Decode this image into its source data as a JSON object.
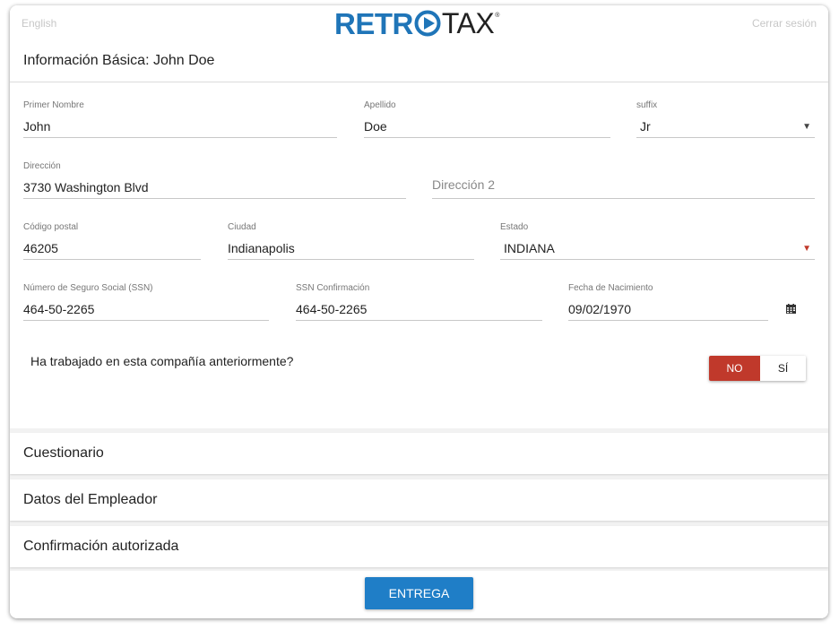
{
  "header": {
    "language": "English",
    "logout": "Cerrar sesión",
    "logo_left": "RETR",
    "logo_right": "TAX",
    "logo_reg": "®",
    "brand_color": "#1f75b8"
  },
  "section_basic": {
    "title": "Información Básica: John Doe",
    "fields": {
      "first_name": {
        "label": "Primer Nombre",
        "value": "John"
      },
      "last_name": {
        "label": "Apellido",
        "value": "Doe"
      },
      "suffix": {
        "label": "suffix",
        "value": "Jr"
      },
      "address": {
        "label": "Dirección",
        "value": "3730 Washington Blvd"
      },
      "address2": {
        "placeholder": "Dirección 2"
      },
      "zip": {
        "label": "Código postal",
        "value": "46205"
      },
      "city": {
        "label": "Ciudad",
        "value": "Indianapolis"
      },
      "state": {
        "label": "Estado",
        "value": "INDIANA"
      },
      "ssn": {
        "label": "Número de Seguro Social (SSN)",
        "value": "464-50-2265"
      },
      "ssn_confirm": {
        "label": "SSN Confirmación",
        "value": "464-50-2265"
      },
      "dob": {
        "label": "Fecha de Nacimiento",
        "value": "09/02/1970"
      }
    },
    "question": "Ha trabajado en esta compañía anteriormente?",
    "toggle": {
      "no": "NO",
      "yes": "SÍ",
      "selected": "NO",
      "selected_color": "#c0392b"
    }
  },
  "accordion": [
    {
      "title": "Cuestionario"
    },
    {
      "title": "Datos del Empleador"
    },
    {
      "title": "Confirmación autorizada"
    }
  ],
  "footer": {
    "submit_label": "ENTREGA",
    "submit_color": "#1f7ec7"
  }
}
